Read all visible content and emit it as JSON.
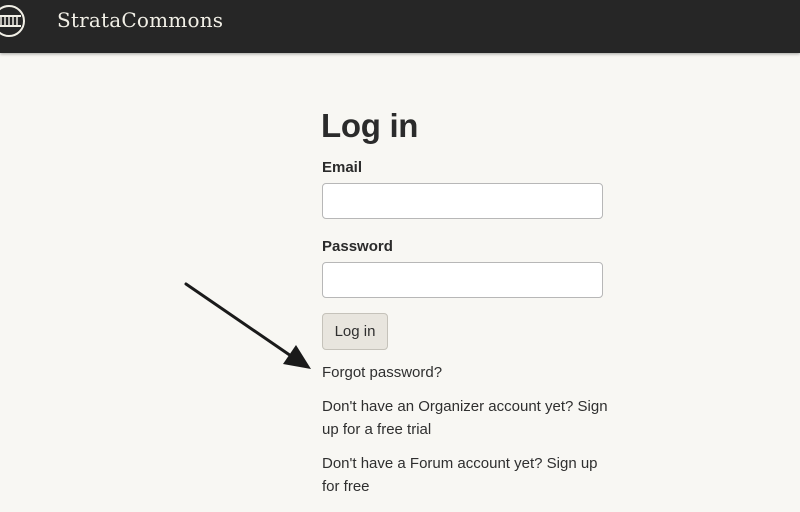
{
  "header": {
    "brand": "StrataCommons",
    "logo_icon": "building-icon",
    "background_color": "#262626"
  },
  "login": {
    "title": "Log in",
    "email_label": "Email",
    "email_value": "",
    "password_label": "Password",
    "password_value": "",
    "submit_label": "Log in"
  },
  "links": {
    "forgot_password": "Forgot password?",
    "organizer_signup": "Don't have an Organizer account yet? Sign up for a free trial",
    "forum_signup": "Don't have a Forum account yet? Sign up for free"
  },
  "annotation": {
    "arrow_icon": "arrow-icon",
    "arrow_color": "#1a1a1a"
  },
  "colors": {
    "page_background": "#f8f7f3",
    "button_background": "#e8e5de"
  }
}
